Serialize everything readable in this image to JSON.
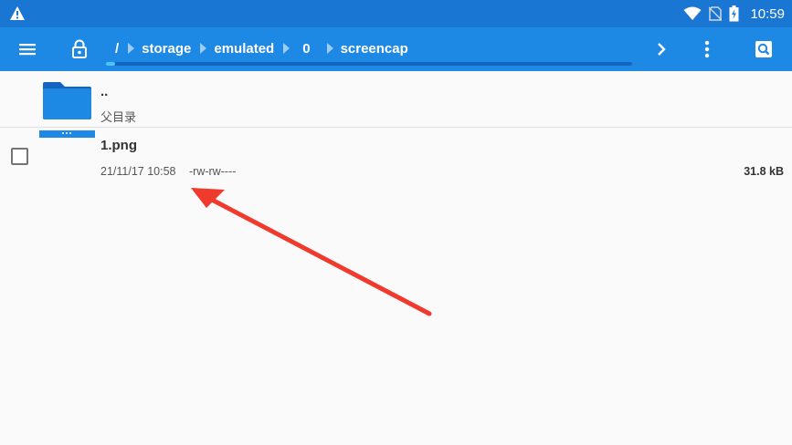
{
  "status_bar": {
    "time": "10:59",
    "icons": [
      "warning-icon",
      "wifi-icon",
      "no-sim-icon",
      "battery-charging-icon"
    ]
  },
  "toolbar": {
    "menu_icon": "hamburger-menu-icon",
    "lock_icon": "lock-icon",
    "breadcrumb": [
      "/",
      "storage",
      "emulated",
      "0",
      "screencap"
    ],
    "chevron_icon": "chevron-right-icon",
    "more_icon": "more-vertical-icon",
    "search_icon": "search-icon",
    "accent_color": "#1e88e5"
  },
  "file_list": {
    "parent": {
      "name": "..",
      "subtitle": "父目录",
      "icon": "folder-icon"
    },
    "items": [
      {
        "name": "1.png",
        "date": "21/11/17 10:58",
        "permissions": "-rw-rw----",
        "size": "31.8 kB",
        "checked": false
      }
    ]
  },
  "annotation": {
    "type": "red-arrow",
    "color": "#f03a2e"
  }
}
